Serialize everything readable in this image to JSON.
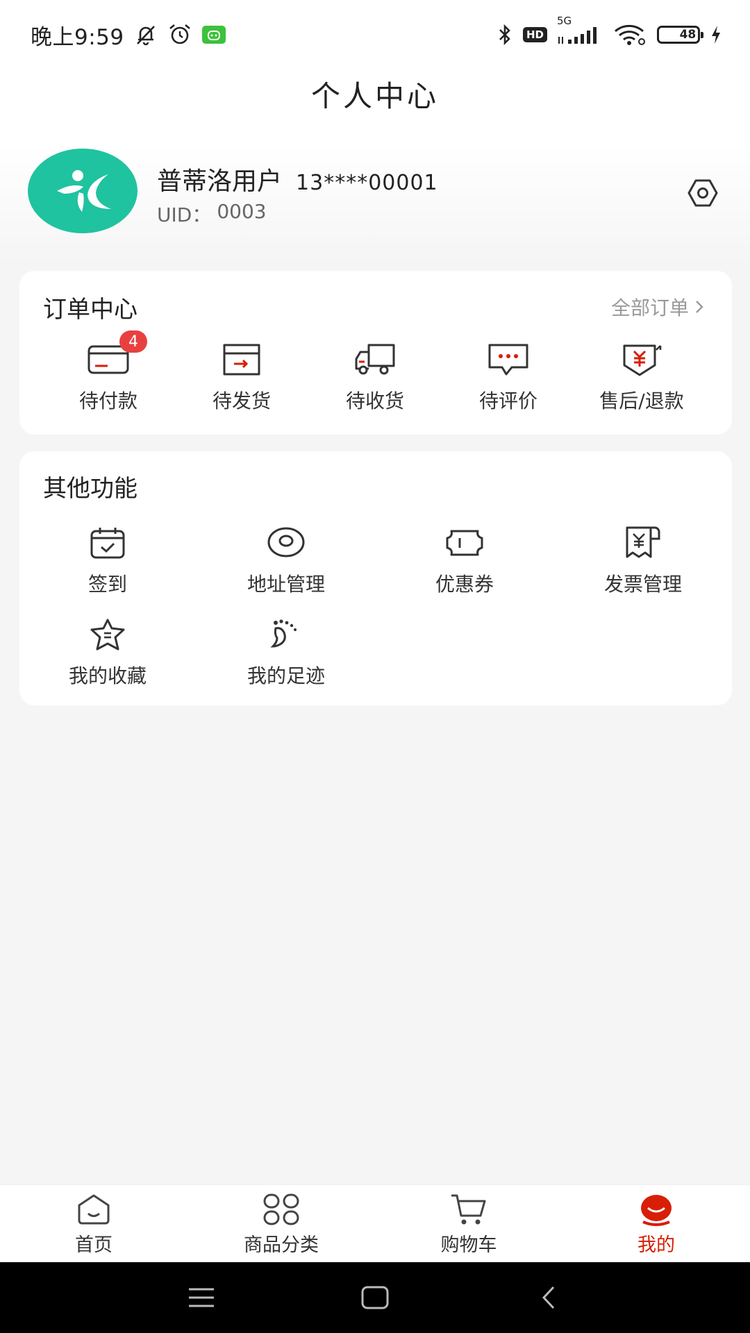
{
  "status_bar": {
    "time": "晚上9:59",
    "network": "5G",
    "hd": "HD",
    "battery": "48"
  },
  "header": {
    "title": "个人中心"
  },
  "profile": {
    "name": "普蒂洛用户",
    "phone": "13****00001",
    "uid_label": "UID：",
    "uid_value": "0003"
  },
  "orders": {
    "title": "订单中心",
    "all_label": "全部订单",
    "items": [
      {
        "label": "待付款",
        "icon": "card-icon",
        "badge": "4"
      },
      {
        "label": "待发货",
        "icon": "box-icon"
      },
      {
        "label": "待收货",
        "icon": "truck-icon"
      },
      {
        "label": "待评价",
        "icon": "chat-icon"
      },
      {
        "label": "售后/退款",
        "icon": "refund-icon"
      }
    ]
  },
  "functions": {
    "title": "其他功能",
    "items": [
      {
        "label": "签到",
        "icon": "calendar-check-icon"
      },
      {
        "label": "地址管理",
        "icon": "location-icon"
      },
      {
        "label": "优惠券",
        "icon": "coupon-icon"
      },
      {
        "label": "发票管理",
        "icon": "invoice-icon"
      },
      {
        "label": "我的收藏",
        "icon": "star-icon"
      },
      {
        "label": "我的足迹",
        "icon": "footprint-icon"
      }
    ]
  },
  "tabbar": {
    "items": [
      {
        "label": "首页",
        "icon": "home-icon"
      },
      {
        "label": "商品分类",
        "icon": "category-icon"
      },
      {
        "label": "购物车",
        "icon": "cart-icon"
      },
      {
        "label": "我的",
        "icon": "profile-icon",
        "active": true
      }
    ],
    "active_color": "#d81e06"
  },
  "colors": {
    "accent": "#d81e06",
    "badge": "#e8403f",
    "avatar": "#1fc39f"
  }
}
